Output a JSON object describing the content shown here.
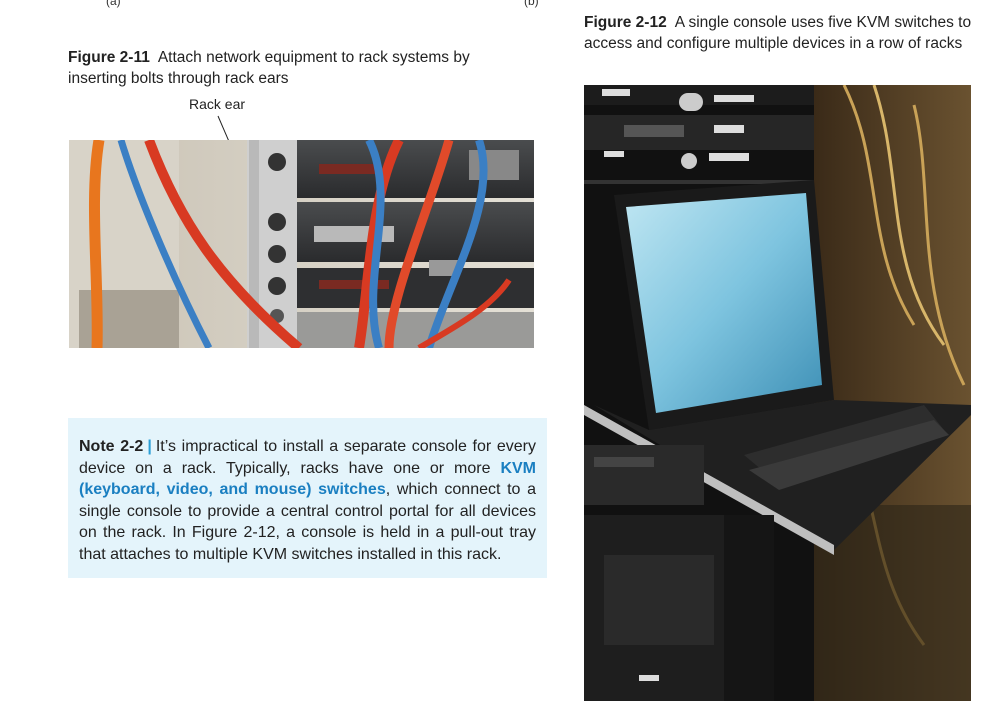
{
  "top_labels": {
    "left": "(a)",
    "right": "(b)"
  },
  "figure_2_11": {
    "number": "Figure 2-11",
    "caption": "Attach network equipment to rack systems by inserting bolts through rack ears",
    "callout": "Rack ear"
  },
  "figure_2_12": {
    "number": "Figure 2-12",
    "caption": "A single console uses five KVM switches to access and configure multiple devices in a row of racks"
  },
  "note": {
    "title": "Note 2-2",
    "separator": "|",
    "text_before": "It’s impractical to install a separate console for every device on a rack. Typically, racks have one or more",
    "term": "KVM (keyboard, video, and mouse) switches",
    "text_after": ", which connect to a single console to provide a central control portal for all devices on the rack. In Figure 2-12, a console is held in a pull-out tray that attaches to multiple KVM switches installed in this rack."
  }
}
